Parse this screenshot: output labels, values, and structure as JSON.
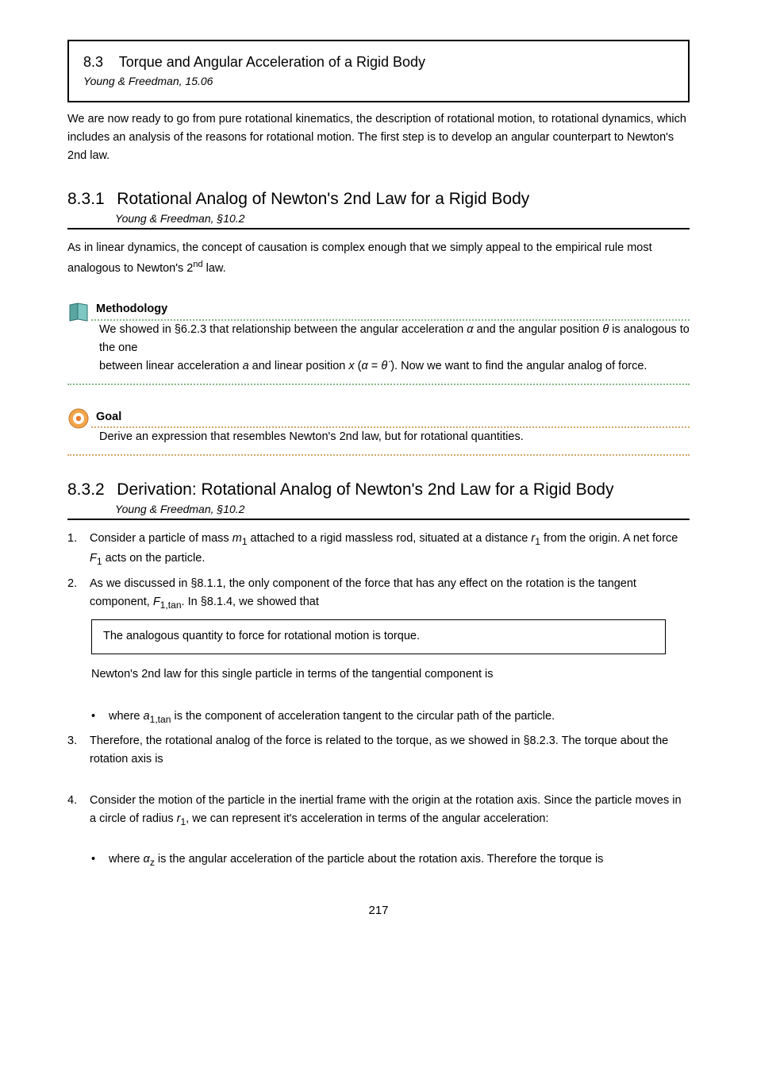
{
  "header": {
    "section_number": "8.3",
    "section_title": "Torque and Angular Acceleration of a Rigid Body",
    "section_subtitle": "Young & Freedman, 15.06"
  },
  "intro_para": "We are now ready to go from pure rotational kinematics, the description of rotational motion, to rotational dynamics, which includes an analysis of the reasons for rotational motion. The first step is to develop an angular counterpart to Newton's 2nd law.",
  "sub1": {
    "num": "8.3.1",
    "title": "Rotational Analog of Newton's 2nd Law for a Rigid Body",
    "subtitle": "Young & Freedman, §10.2"
  },
  "method": {
    "label": "Methodology",
    "line1_prefix": "We showed in §6.2.3 that relationship between the angular acceleration ",
    "line1_greek1": "α",
    "line1_mid": " and the angular position ",
    "line1_greek2": "θ",
    "line1_end": " is analogous to the one",
    "line2_prefix": "between linear acceleration ",
    "line2_a": "a",
    "line2_mid": " and linear position ",
    "line2_x": "x",
    "line2_paren_open": " (",
    "line2_alpha": "α",
    "line2_eq": " = ",
    "line2_theta": "θ",
    "line2_dd": " ̈",
    "line2_close": ").",
    "line2_tail": " Now we want to find the angular analog of force."
  },
  "goal": {
    "label": "Goal",
    "text": "Derive an expression that resembles Newton's 2nd law, but for rotational quantities."
  },
  "sub2": {
    "num": "8.3.2",
    "title": "Derivation: Rotational Analog of Newton's 2nd Law for a Rigid Body",
    "subtitle": "Young & Freedman, §10.2"
  },
  "step1": {
    "n": "1.",
    "prefix": "Consider a particle of mass ",
    "m1": "m",
    "sub1": "1",
    "mid1": " attached to a rigid massless rod, situated at a distance ",
    "r1": "r",
    "end1": " from the origin. A net force",
    "line2_F": "F",
    "line2_sub": "1",
    "line2_txt": " acts on the particle."
  },
  "step2": {
    "n": "2.",
    "prefix": "As we discussed in §8.1.1, the only component of the force that has any effect on the rotation is the tangent component, ",
    "F": "F",
    "sub": "1,tan",
    "tail": ". In §8.1.4, we showed that"
  },
  "quote": "The analogous quantity to force for rotational motion is torque.",
  "after_quote": "Newton's 2nd law for this single particle in terms of the tangential component is",
  "bullet_a": {
    "dot": "•",
    "text_pre": "where ",
    "a": "a",
    "sub": "1,tan",
    "text_post": " is the component of acceleration tangent to the circular path of the particle."
  },
  "step3": {
    "n": "3.",
    "text": "Therefore, the rotational analog of the force is related to the torque, as we showed in §8.2.3. The torque about the rotation axis is"
  },
  "step4": {
    "n": "4.",
    "prefix": "Consider the motion of the particle in the inertial frame with the origin at the rotation axis. Since the particle moves in a circle of radius ",
    "r": "r",
    "sub": "1",
    "tail": ", we can represent it's acceleration in terms of the angular acceleration:"
  },
  "bullet_b": {
    "dot": "•",
    "prefix": "where ",
    "alpha": "α",
    "sub": "z",
    "tail": " is the angular acceleration of the particle about the rotation axis. Therefore the torque is"
  },
  "page_number": "217"
}
